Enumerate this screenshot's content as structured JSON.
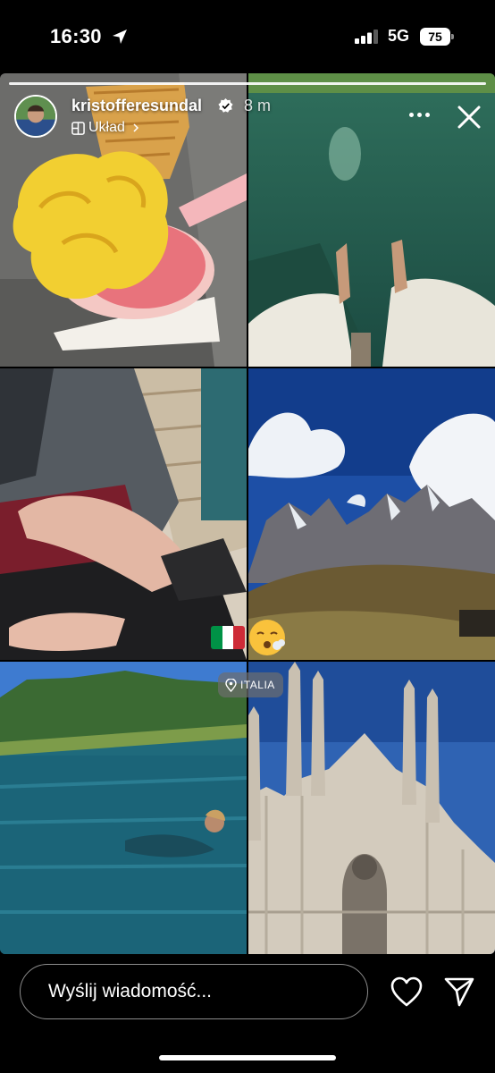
{
  "status_bar": {
    "time": "16:30",
    "network": "5G",
    "battery": "75",
    "location_icon": "location-arrow-icon",
    "signal_icon": "cellular-signal-icon"
  },
  "story": {
    "progress": 1.0,
    "author": {
      "username": "kristofferesundal",
      "verified": true,
      "time_ago": "8 m",
      "avatar_icon": "avatar"
    },
    "layout_tag": {
      "label": "Układ",
      "icon": "layout-grid-icon"
    },
    "controls": {
      "more_icon": "more-horizontal-icon",
      "close_icon": "close-icon"
    },
    "photos": [
      "ice-cream-photo",
      "lake-feet-photo",
      "hands-on-bag-photo",
      "mountains-photo",
      "lake-swimmer-photo",
      "cathedral-photo"
    ],
    "stickers": {
      "flag": "italy-flag",
      "flag_colors": [
        "#009246",
        "#ffffff",
        "#ce2b37"
      ],
      "emoji": "face-exhaling-emoji",
      "location": "ITALIA"
    }
  },
  "reply_bar": {
    "placeholder": "Wyślij wiadomość...",
    "like_icon": "heart-icon",
    "share_icon": "send-icon"
  }
}
